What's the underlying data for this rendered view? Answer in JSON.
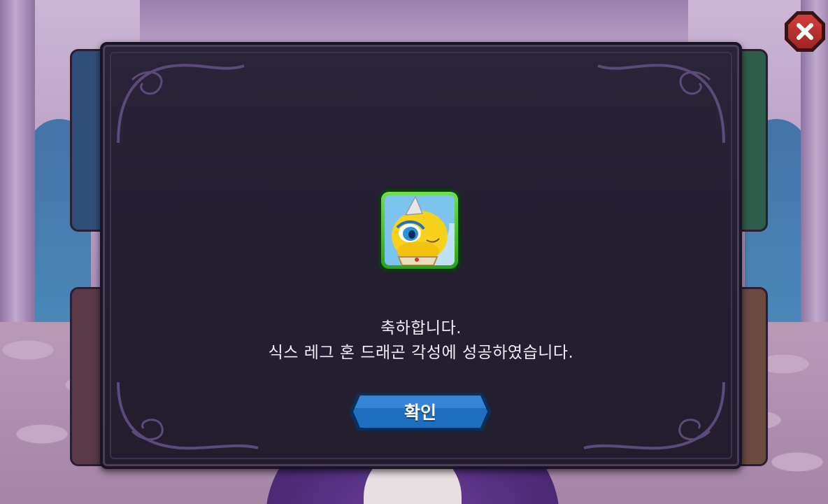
{
  "dialog": {
    "line1": "축하합니다.",
    "line2": "식스 레그 혼 드래곤 각성에 성공하였습니다.",
    "confirm_label": "확인"
  },
  "icons": {
    "close": "close-x-icon",
    "hero": "dragon-hero-portrait"
  },
  "colors": {
    "panel": "#251f32",
    "portrait_border": "#3fbf2a",
    "confirm_button": "#1f6fc0",
    "close_button": "#c23330"
  }
}
